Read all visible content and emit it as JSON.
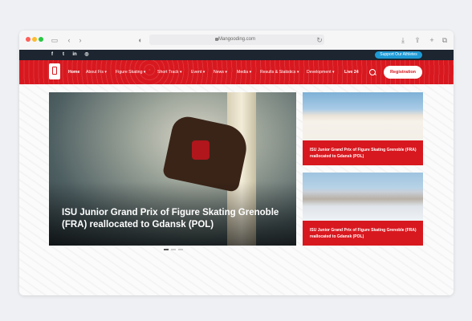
{
  "browser": {
    "url": "Mangooding.com",
    "traffic_lights": [
      "#fe5f57",
      "#febc2e",
      "#28c840"
    ]
  },
  "topbar": {
    "social": [
      "facebook-icon",
      "twitter-icon",
      "linkedin-icon",
      "instagram-icon"
    ],
    "support_label": "Support Our Athletes"
  },
  "nav": {
    "items": [
      {
        "label": "Home",
        "active": true
      },
      {
        "label": "About Fis ▾"
      },
      {
        "label": "Figure Skating ▾"
      },
      {
        "label": "Short Track ▾"
      },
      {
        "label": "Event ▾"
      },
      {
        "label": "News ▾"
      },
      {
        "label": "Media ▾"
      },
      {
        "label": "Results & Statistics ▾"
      },
      {
        "label": "Development ▾"
      },
      {
        "label": "Live 24"
      }
    ],
    "register_label": "Registration"
  },
  "hero": {
    "title": "ISU Junior Grand Prix of Figure Skating Grenoble (FRA) reallocated to Gdansk (POL)"
  },
  "side_cards": [
    {
      "title": "ISU Junior Grand Prix of Figure Skating Grenoble (FRA) reallocated to Gdansk (POL)"
    },
    {
      "title": "ISU Junior Grand Prix of Figure Skating Grenoble (FRA) reallocated to Gdansk (POL)"
    }
  ],
  "colors": {
    "brand_red": "#d8181f",
    "dark_bar": "#1c2530",
    "support_blue": "#1e9ad6"
  }
}
